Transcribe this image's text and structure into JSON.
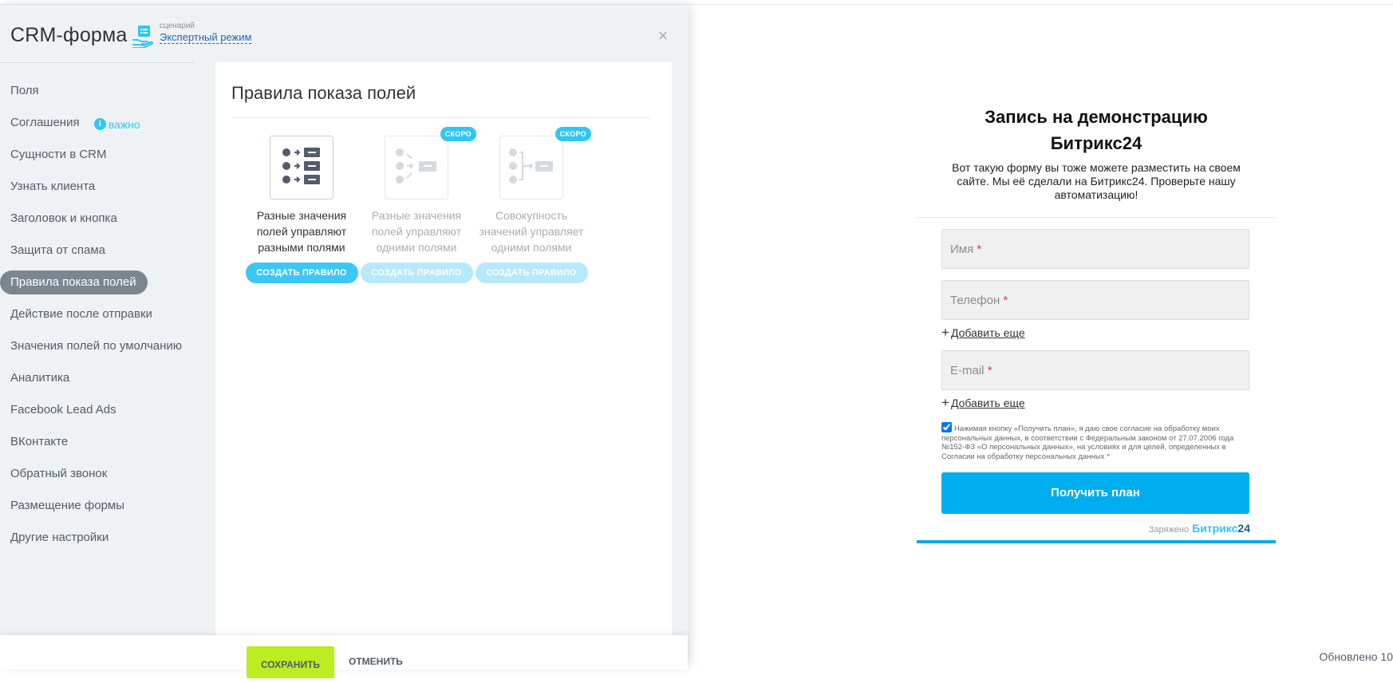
{
  "panel": {
    "title": "CRM-форма",
    "scenario_caption": "сценарий",
    "scenario_link": "Экспертный режим",
    "close_glyph": "×"
  },
  "menu": {
    "items": [
      {
        "label": "Поля"
      },
      {
        "label": "Соглашения",
        "hint": "важно"
      },
      {
        "label": "Сущности в CRM"
      },
      {
        "label": "Узнать клиента"
      },
      {
        "label": "Заголовок и кнопка"
      },
      {
        "label": "Защита от спама"
      },
      {
        "label": "Правила показа полей",
        "active": true
      },
      {
        "label": "Действие после отправки"
      },
      {
        "label": "Значения полей по умолчанию"
      },
      {
        "label": "Аналитика"
      },
      {
        "label": "Facebook Lead Ads"
      },
      {
        "label": "ВКонтакте"
      },
      {
        "label": "Обратный звонок"
      },
      {
        "label": "Размещение формы"
      },
      {
        "label": "Другие настройки"
      }
    ]
  },
  "rules": {
    "title": "Правила показа полей",
    "items": [
      {
        "desc": "Разные значения полей управляют разными полями",
        "button": "СОЗДАТЬ ПРАВИЛО",
        "badge": "",
        "enabled": true
      },
      {
        "desc": "Разные значения полей управляют одними полями",
        "button": "СОЗДАТЬ ПРАВИЛО",
        "badge": "СКОРО",
        "enabled": false
      },
      {
        "desc": "Совокупность значений управляет одними полями",
        "button": "СОЗДАТЬ ПРАВИЛО",
        "badge": "СКОРО",
        "enabled": false
      }
    ]
  },
  "footer": {
    "save": "СОХРАНИТЬ",
    "cancel": "ОТМЕНИТЬ"
  },
  "preview": {
    "title": "Запись на демонстрацию Битрикс24",
    "subtitle": "Вот такую форму вы тоже можете разместить на своем сайте. Мы её сделали на Битрикс24. Проверьте нашу автоматизацию!",
    "fields": {
      "name": "Имя",
      "phone": "Телефон",
      "email": "E-mail"
    },
    "required_mark": "*",
    "add_more": "Добавить еще",
    "add_more_plus": "+",
    "consent_checked": true,
    "consent_text": "Нажимая кнопку «Получить план», я даю свое согласие на обработку моих персональных данных, в соответствии с Федеральным законом от 27.07.2006 года №152-ФЗ «О персональных данных», на условиях и для целей, определенных в Согласии на обработку персональных данных",
    "submit": "Получить план",
    "powered_by": "Заряжено",
    "brand_main": "Битрикс",
    "brand_num": "24"
  },
  "status": {
    "updated": "Обновлено 10"
  },
  "colors": {
    "accent": "#2fc6f6",
    "save_button": "#bbed21",
    "submit_button": "#00aeef",
    "active_menu": "#7b8691"
  }
}
